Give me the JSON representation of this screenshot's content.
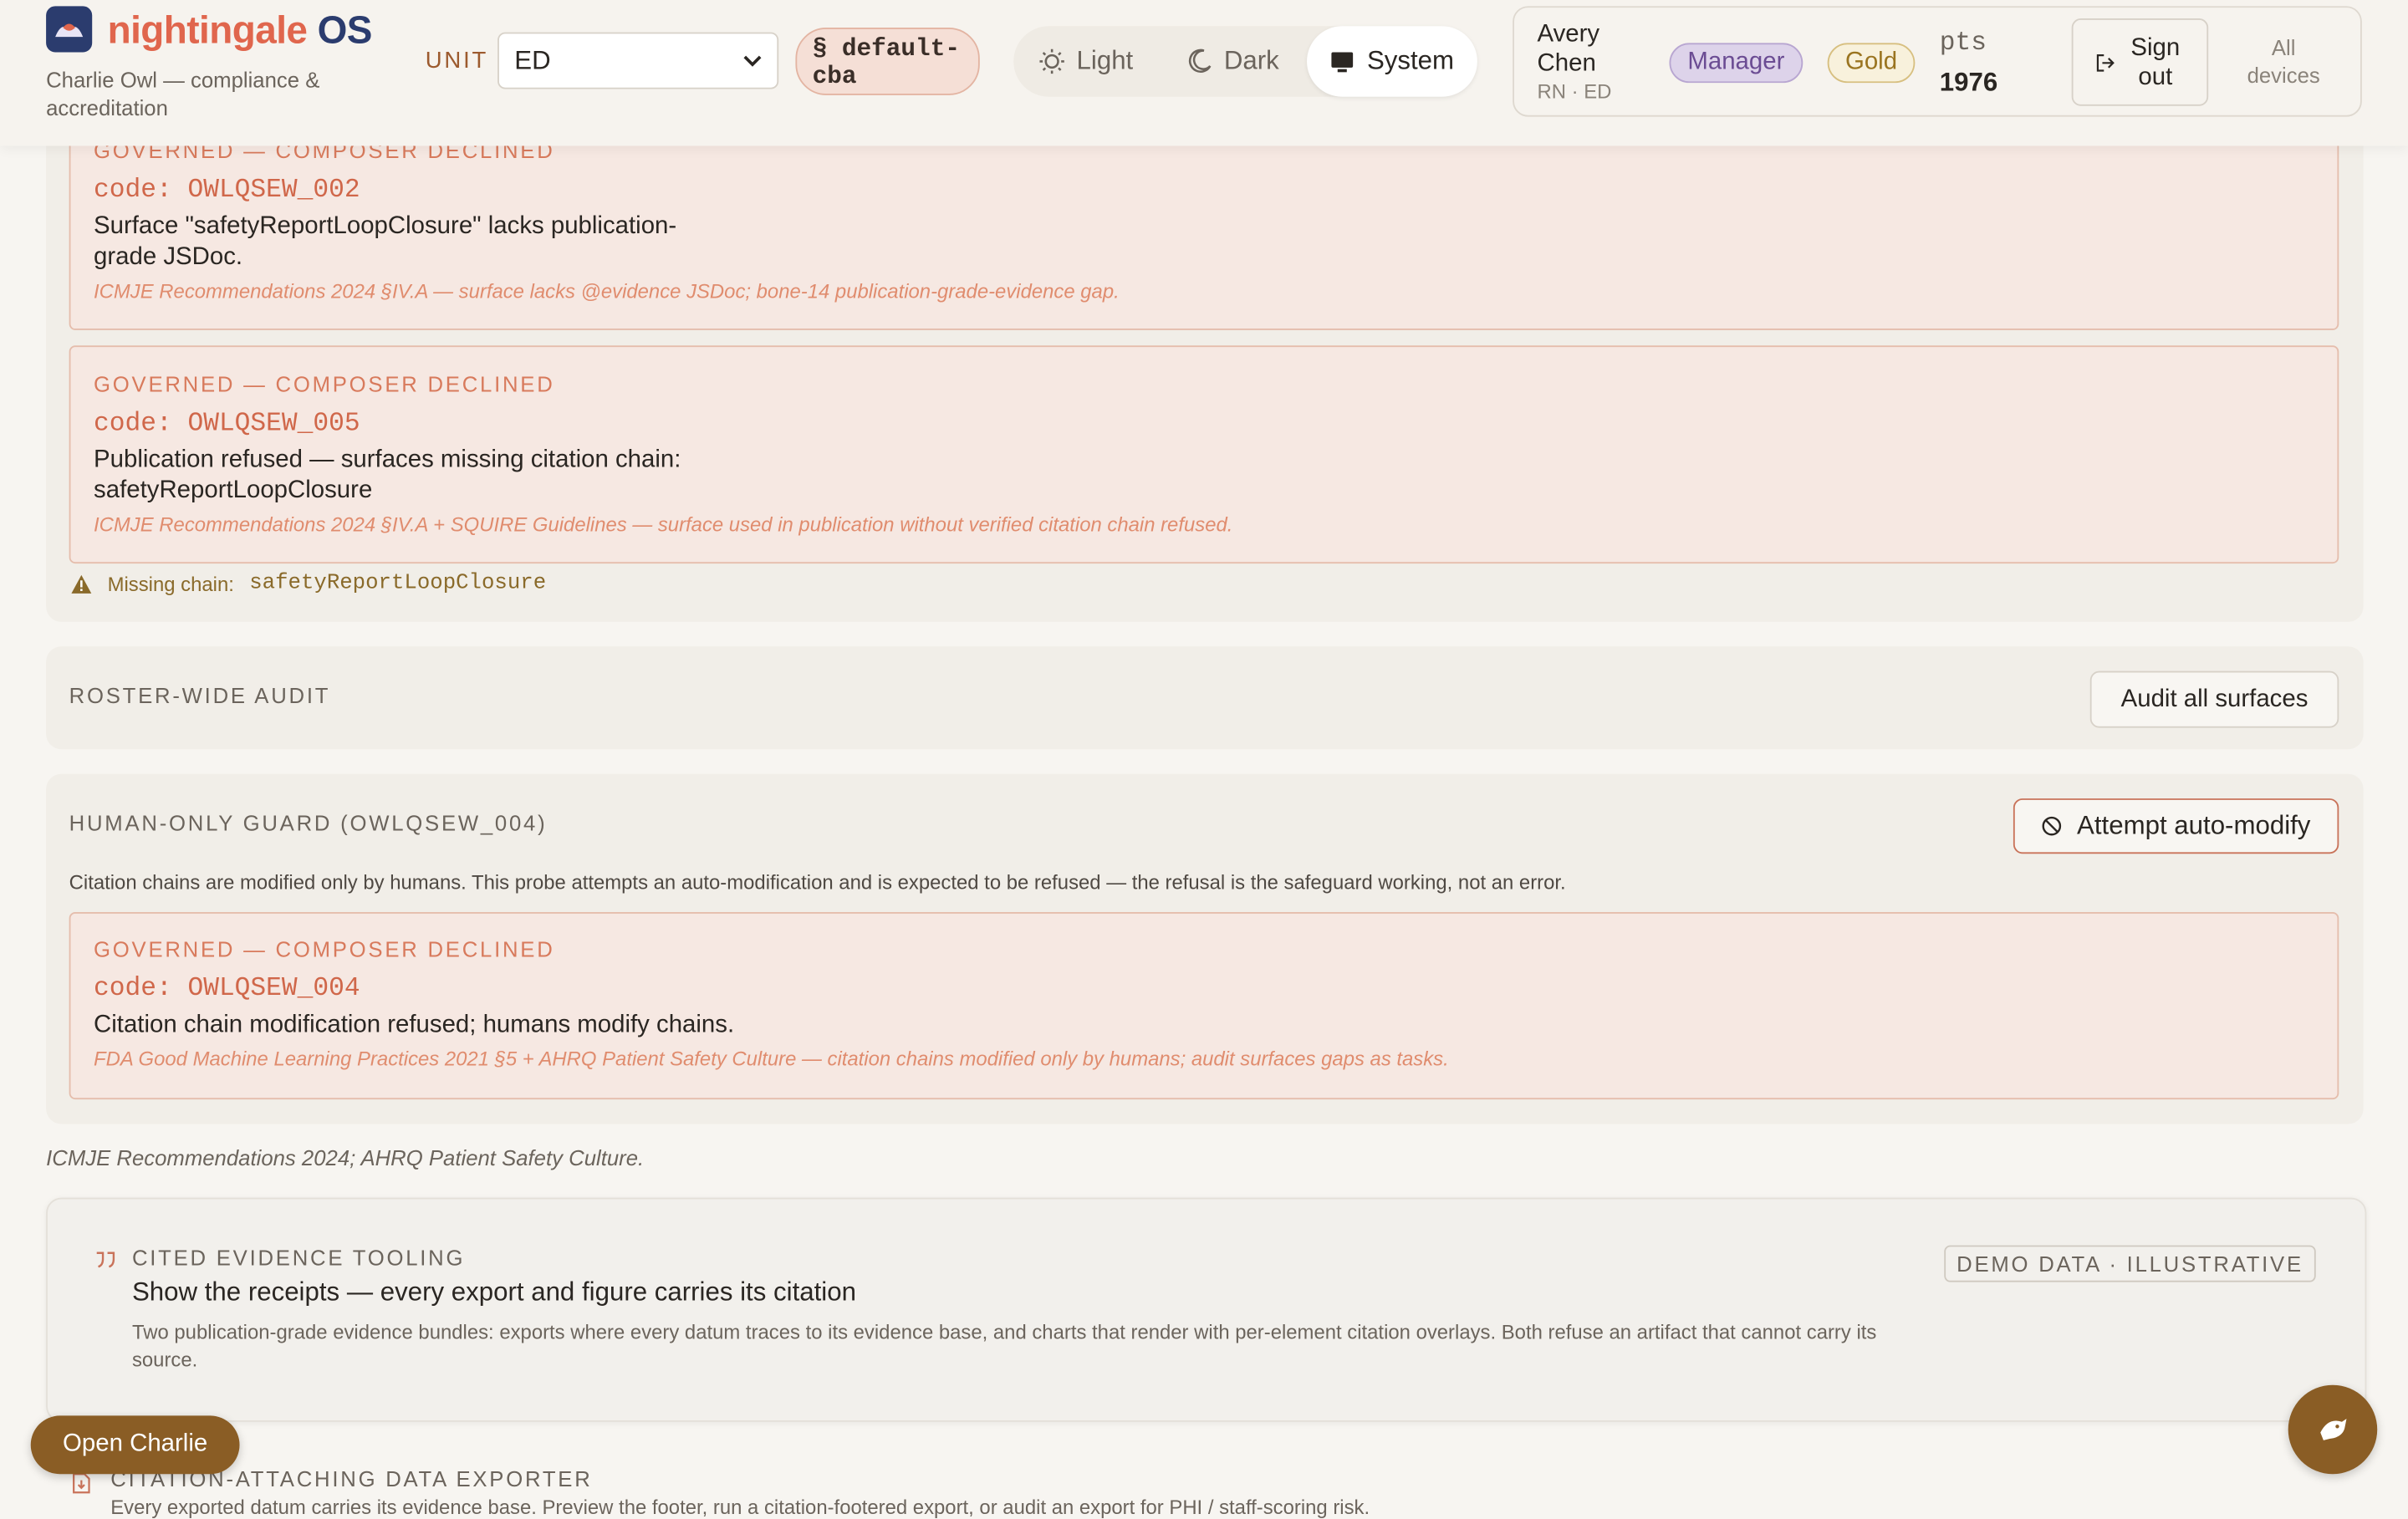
{
  "header": {
    "brand_part1": "nightingale",
    "brand_part2": "OS",
    "subtitle": "Charlie Owl — compliance & accreditation",
    "unit_label": "UNIT",
    "unit_value": "ED",
    "cba_pill": "§ default-cba",
    "theme": {
      "light": "Light",
      "dark": "Dark",
      "system": "System",
      "selected": "System"
    },
    "user": {
      "name": "Avery Chen",
      "meta": "RN · ED",
      "role_badge": "Manager",
      "tier_badge": "Gold",
      "pts_label": "pts",
      "pts_value": "1976"
    },
    "sign_out": "Sign out",
    "all_devices": "All devices"
  },
  "governed_blocks": [
    {
      "label": "GOVERNED — COMPOSER DECLINED",
      "code": "code: OWLQSEW_002",
      "message": "Surface \"safetyReportLoopClosure\" lacks publication-grade JSDoc.",
      "citation": "ICMJE Recommendations 2024 §IV.A — surface lacks @evidence JSDoc; bone-14 publication-grade-evidence gap."
    },
    {
      "label": "GOVERNED — COMPOSER DECLINED",
      "code": "code: OWLQSEW_005",
      "message": "Publication refused — surfaces missing citation chain: safetyReportLoopClosure",
      "citation": "ICMJE Recommendations 2024 §IV.A + SQUIRE Guidelines — surface used in publication without verified citation chain refused."
    }
  ],
  "missing_chain": {
    "label": "Missing chain:",
    "value": "safetyReportLoopClosure"
  },
  "roster_audit": {
    "title": "ROSTER-WIDE AUDIT",
    "button": "Audit all surfaces"
  },
  "human_guard": {
    "title": "HUMAN-ONLY GUARD (OWLQSEW_004)",
    "button": "Attempt auto-modify",
    "description": "Citation chains are modified only by humans. This probe attempts an auto-modification and is expected to be refused — the refusal is the safeguard working, not an error.",
    "block": {
      "label": "GOVERNED — COMPOSER DECLINED",
      "code": "code: OWLQSEW_004",
      "message": "Citation chain modification refused; humans modify chains.",
      "citation": "FDA Good Machine Learning Practices 2021 §5 + AHRQ Patient Safety Culture — citation chains modified only by humans; audit surfaces gaps as tasks."
    }
  },
  "footnote": "ICMJE Recommendations 2024; AHRQ Patient Safety Culture.",
  "evidence_card": {
    "eyebrow": "CITED EVIDENCE TOOLING",
    "title": "Show the receipts — every export and figure carries its citation",
    "description": "Two publication-grade evidence bundles: exports where every datum traces to its evidence base, and charts that render with per-element citation overlays. Both refuse an artifact that cannot carry its source.",
    "badge": "DEMO DATA · ILLUSTRATIVE"
  },
  "exporter": {
    "title": "CITATION-ATTACHING DATA EXPORTER",
    "description": "Every exported datum carries its evidence base. Preview the footer, run a citation-footered export, or audit an export for PHI / staff-scoring risk."
  },
  "charlie_button": "Open Charlie",
  "colors": {
    "accent": "#e0664d",
    "brand_navy": "#2b3c6e",
    "gold_brown": "#8a5d25",
    "governed_bg": "#f6e8e2"
  }
}
